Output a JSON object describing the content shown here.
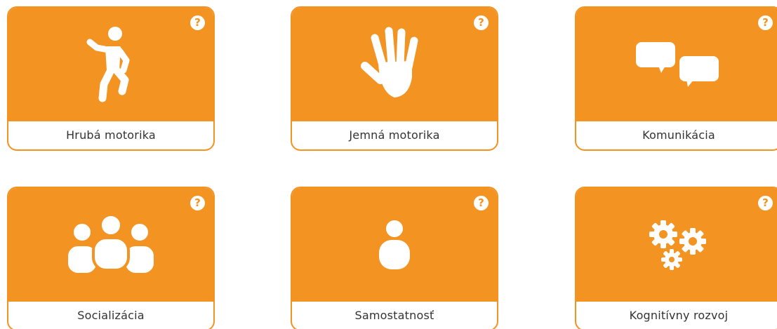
{
  "accent_color": "#f39322",
  "help_glyph": "?",
  "cards": [
    {
      "label": "Hrubá motorika",
      "icon": "running-person-icon"
    },
    {
      "label": "Jemná motorika",
      "icon": "hand-icon"
    },
    {
      "label": "Komunikácia",
      "icon": "speech-bubbles-icon"
    },
    {
      "label": "Socializácia",
      "icon": "group-icon"
    },
    {
      "label": "Samostatnosť",
      "icon": "person-icon"
    },
    {
      "label": "Kognitívny rozvoj",
      "icon": "gears-icon"
    }
  ]
}
